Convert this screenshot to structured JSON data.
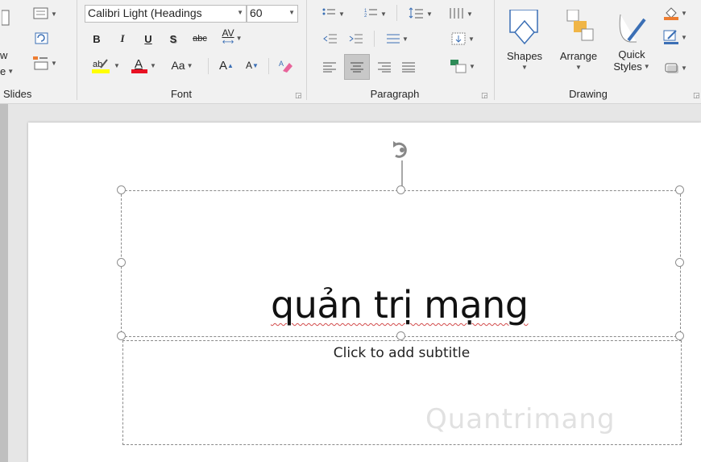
{
  "ribbon": {
    "slides_group": {
      "label": "Slides",
      "new_slide_partial": "w",
      "new_slide_partial2": "e"
    },
    "font_group": {
      "label": "Font",
      "font_name": "Calibri Light (Headings",
      "font_size": "60",
      "bold": "B",
      "italic": "I",
      "underline": "U",
      "shadow": "S",
      "strikethrough": "abc",
      "char_spacing": "AV",
      "change_case": "Aa",
      "grow_font": "A",
      "shrink_font": "A"
    },
    "paragraph_group": {
      "label": "Paragraph"
    },
    "drawing_group": {
      "label": "Drawing",
      "shapes": "Shapes",
      "arrange": "Arrange",
      "quick_styles_line1": "Quick",
      "quick_styles_line2": "Styles"
    }
  },
  "slide": {
    "title": "quản trị mạng",
    "subtitle_placeholder": "Click to add subtitle"
  },
  "watermark": "Quantrimang",
  "colors": {
    "highlight": "#ffff00",
    "font_color": "#e81123",
    "fill_accent": "#ed7d31"
  }
}
